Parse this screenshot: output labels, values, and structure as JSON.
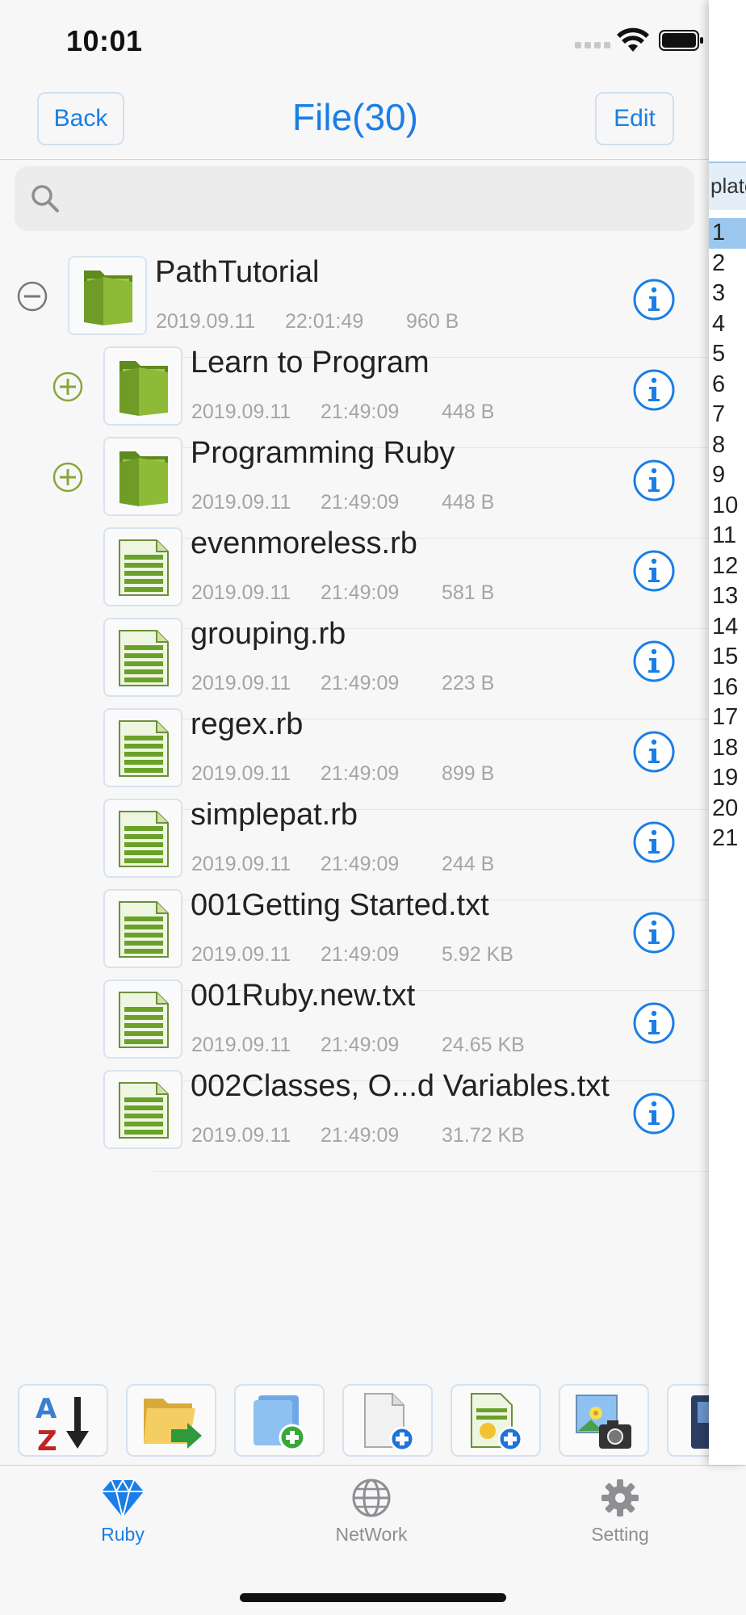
{
  "status": {
    "time": "10:01"
  },
  "nav": {
    "back_label": "Back",
    "title": "File(30)",
    "edit_label": "Edit"
  },
  "search": {
    "placeholder": ""
  },
  "files": [
    {
      "name": "PathTutorial",
      "date": "2019.09.11",
      "time": "22:01:49",
      "size": "960 B",
      "kind": "folder",
      "expanded": true,
      "indent": 0
    },
    {
      "name": "Learn to Program",
      "date": "2019.09.11",
      "time": "21:49:09",
      "size": "448 B",
      "kind": "folder",
      "expanded": false,
      "indent": 1
    },
    {
      "name": "Programming Ruby",
      "date": "2019.09.11",
      "time": "21:49:09",
      "size": "448 B",
      "kind": "folder",
      "expanded": false,
      "indent": 1
    },
    {
      "name": "evenmoreless.rb",
      "date": "2019.09.11",
      "time": "21:49:09",
      "size": "581 B",
      "kind": "file",
      "indent": 1
    },
    {
      "name": "grouping.rb",
      "date": "2019.09.11",
      "time": "21:49:09",
      "size": "223 B",
      "kind": "file",
      "indent": 1
    },
    {
      "name": "regex.rb",
      "date": "2019.09.11",
      "time": "21:49:09",
      "size": "899 B",
      "kind": "file",
      "indent": 1
    },
    {
      "name": "simplepat.rb",
      "date": "2019.09.11",
      "time": "21:49:09",
      "size": "244 B",
      "kind": "file",
      "indent": 1
    },
    {
      "name": "001Getting Started.txt",
      "date": "2019.09.11",
      "time": "21:49:09",
      "size": "5.92 KB",
      "kind": "file",
      "indent": 1
    },
    {
      "name": "001Ruby.new.txt",
      "date": "2019.09.11",
      "time": "21:49:09",
      "size": "24.65 KB",
      "kind": "file",
      "indent": 1
    },
    {
      "name": "002Classes, O...d Variables.txt",
      "date": "2019.09.11",
      "time": "21:49:09",
      "size": "31.72 KB",
      "kind": "file",
      "indent": 1
    }
  ],
  "toolbar": {
    "buttons": [
      {
        "icon": "sort-az-icon"
      },
      {
        "icon": "move-folder-icon"
      },
      {
        "icon": "new-folder-icon"
      },
      {
        "icon": "new-file-icon"
      },
      {
        "icon": "new-text-file-icon"
      },
      {
        "icon": "photo-camera-icon"
      },
      {
        "icon": "book-icon"
      }
    ]
  },
  "tabs": [
    {
      "label": "Ruby",
      "icon": "ruby-gem-icon",
      "active": true
    },
    {
      "label": "NetWork",
      "icon": "globe-icon",
      "active": false
    },
    {
      "label": "Setting",
      "icon": "gear-icon",
      "active": false
    }
  ],
  "side_panel": {
    "header": "plate",
    "line_numbers": [
      "1",
      "2",
      "3",
      "4",
      "5",
      "6",
      "7",
      "8",
      "9",
      "10",
      "11",
      "12",
      "13",
      "14",
      "15",
      "16",
      "17",
      "18",
      "19",
      "20",
      "21"
    ],
    "active_line": "1"
  },
  "colors": {
    "accent": "#1a7ee6",
    "folder_green": "#7fae2e",
    "meta_gray": "#a5a5a5"
  }
}
